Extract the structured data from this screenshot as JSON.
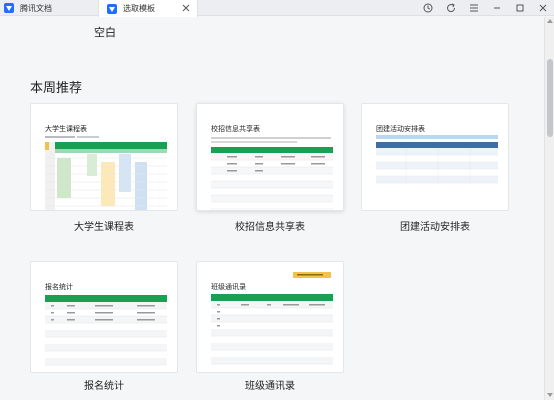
{
  "tabs": [
    {
      "label": "腾讯文档",
      "icon": "tencent-docs-icon"
    },
    {
      "label": "选取模板",
      "icon": "tencent-docs-icon",
      "active": true
    }
  ],
  "window_controls": [
    "history-icon",
    "refresh-icon",
    "menu-icon",
    "minimize-icon",
    "maximize-icon",
    "close-icon"
  ],
  "blank": {
    "label": "空白"
  },
  "section": {
    "title": "本周推荐"
  },
  "templates": [
    {
      "label": "大学生课程表",
      "preview_title": "大学生课程表"
    },
    {
      "label": "校招信息共享表",
      "preview_title": "校招信息共享表"
    },
    {
      "label": "团建活动安排表",
      "preview_title": "团建活动安排表"
    },
    {
      "label": "报名统计",
      "preview_title": "报名统计"
    },
    {
      "label": "班级通讯录",
      "preview_title": "班级通讯录"
    }
  ],
  "colors": {
    "brand": "#1e6fff",
    "sheet_green": "#1aa053",
    "sheet_blue": "#3f6ea7",
    "sheet_yellow": "#f3c24b"
  }
}
